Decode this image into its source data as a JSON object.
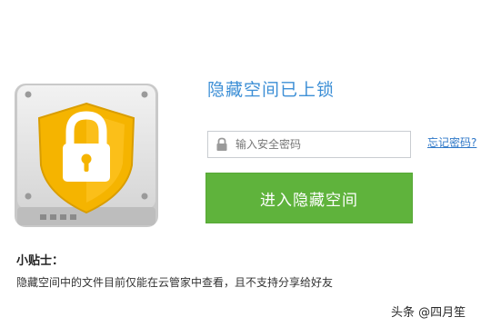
{
  "heading": "隐藏空间已上锁",
  "password": {
    "placeholder": "输入安全密码",
    "value": ""
  },
  "forgot_link": "忘记密码?",
  "enter_button": "进入隐藏空间",
  "tip": {
    "title": "小贴士：",
    "body": "隐藏空间中的文件目前仅能在云管家中查看，且不支持分享给好友"
  },
  "watermark": "头条 @四月笙",
  "icons": {
    "safe": "locked-safe-shield-icon",
    "field": "lock-icon"
  },
  "colors": {
    "accent_green": "#5fb33c",
    "title_blue": "#3d8fd6",
    "link_blue": "#2f78c8",
    "shield_yellow": "#f5b400"
  }
}
